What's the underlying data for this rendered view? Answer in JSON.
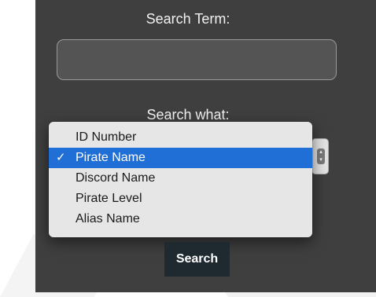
{
  "form": {
    "search_term_label": "Search Term:",
    "search_term_value": "",
    "search_what_label": "Search what:",
    "search_button_label": "Search"
  },
  "dropdown": {
    "selected": "Pirate Name",
    "check_glyph": "✓",
    "options": [
      "ID Number",
      "Pirate Name",
      "Discord Name",
      "Pirate Level",
      "Alias Name"
    ]
  },
  "colors": {
    "panel_background": "#3f3f3f",
    "selected_option": "#1f6fd6",
    "search_button": "#1e2a30"
  }
}
